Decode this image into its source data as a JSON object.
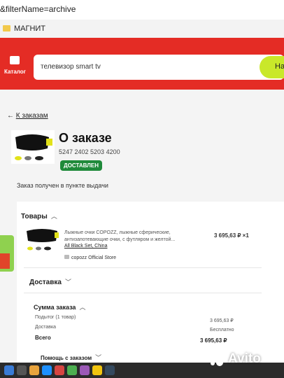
{
  "browser": {
    "url_fragment": "&filterName=archive",
    "bookmark_label": "МАГНИТ"
  },
  "header": {
    "catalog_label": "Каталог",
    "search_value": "телевизор smart tv",
    "search_button_label": "На"
  },
  "order": {
    "back_label": "К заказам",
    "title": "О заказе",
    "number": "5247 2402 5203 4200",
    "status": "ДОСТАВЛЕН",
    "pickup_text": "Заказ получен в пункте выдачи"
  },
  "goods": {
    "section_title": "Товары",
    "item": {
      "description": "Лыжные очки COPOZZ, лыжные сферические, антизапотевающие очки, с футляром и желтой...",
      "variant": "All Black Set, China",
      "price": "3 695,63 ₽ ×1",
      "store": "copozz Official Store"
    }
  },
  "delivery": {
    "section_title": "Доставка"
  },
  "summary": {
    "section_title": "Сумма заказа",
    "rows": [
      {
        "label": "Подытог (1 товар)",
        "value": "3 695,63 ₽"
      },
      {
        "label": "Доставка",
        "value": "Бесплатно"
      },
      {
        "label": "Всего",
        "value": "3 695,63 ₽"
      }
    ]
  },
  "help": {
    "section_title": "Помощь с заказом"
  },
  "watermark": {
    "text": "Avito"
  },
  "colors": {
    "brand_red": "#e42c25",
    "search_accent": "#c9e82a",
    "status_green": "#1f8a3a"
  }
}
